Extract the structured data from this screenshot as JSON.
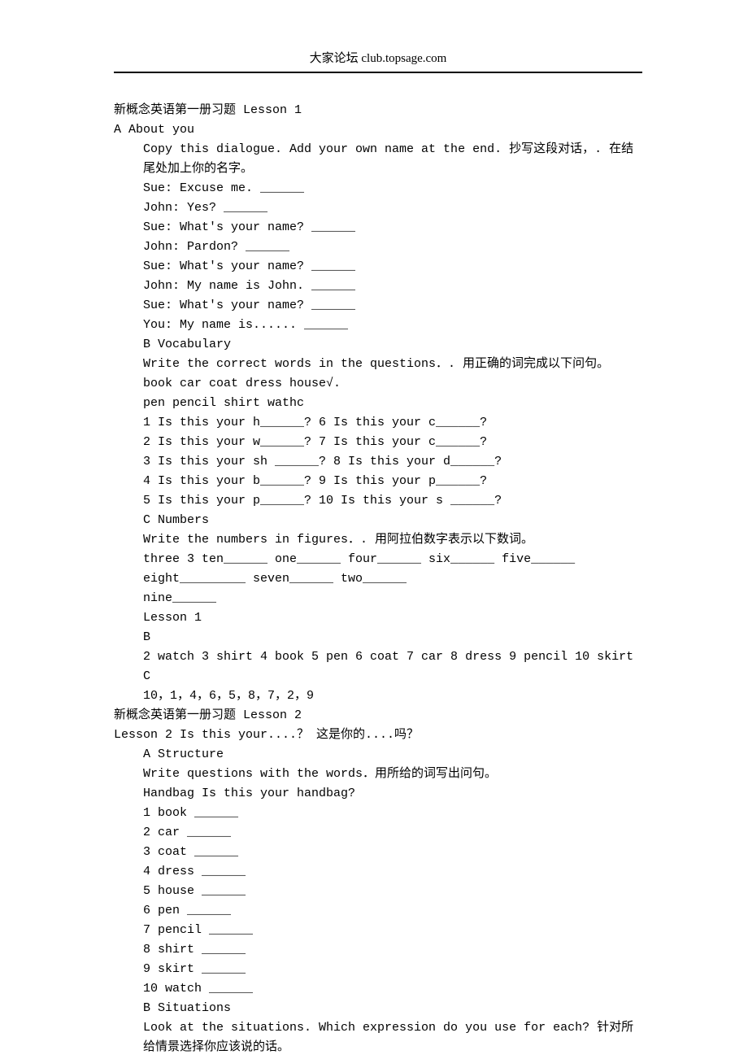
{
  "header": "大家论坛 club.topsage.com",
  "lesson1": {
    "title": "新概念英语第一册习题 Lesson 1",
    "sectionA_label": "A About you",
    "a_instruction": "Copy this dialogue. Add your own name at the end. 抄写这段对话，. 在结尾处加上你的名字。",
    "dialogue": [
      "Sue: Excuse me. ______",
      "John: Yes? ______",
      "Sue: What's your name? ______",
      "John: Pardon? ______",
      "Sue: What's your name? ______",
      "John: My name is John. ______",
      "Sue: What's your name? ______",
      "You: My name is...... ______"
    ],
    "sectionB_label": "B Vocabulary",
    "b_instruction": "Write the correct words in the questions．. 用正确的词完成以下问句。",
    "b_wordlist1": "book car coat dress house√.",
    "b_wordlist2": "pen pencil shirt wathc",
    "b_items": [
      "1 Is this your h______? 6 Is this your c______?",
      "2 Is this your w______? 7 Is this your c______?",
      "3 Is this your sh ______? 8 Is this your d______?",
      "4 Is this your b______? 9 Is this your p______?",
      "5 Is this your p______? 10 Is this your s ______?"
    ],
    "sectionC_label": "C Numbers",
    "c_instruction": "Write the numbers in figures．. 用阿拉伯数字表示以下数词。",
    "c_line1": "three 3 ten______ one______ four______ six______ five______",
    "c_line2": "eight_________ seven______ two______",
    "c_line3": "nine______",
    "answer_heading": "Lesson 1",
    "answer_b_label": "B",
    "answer_b": "2 watch 3 shirt 4 book 5 pen 6 coat 7 car 8 dress 9 pencil 10 skirt",
    "answer_c_label": "C",
    "answer_c": "10，1，4，6，5，8，7，2，9"
  },
  "lesson2": {
    "title": "新概念英语第一册习题 Lesson 2",
    "subtitle": "Lesson 2 Is this your....？ 这是你的....吗？",
    "sectionA_label": "A Structure",
    "a_instruction": "Write questions with the words．用所给的词写出问句。",
    "a_example": "Handbag Is this your handbag?",
    "a_items": [
      "1 book ______",
      "2 car ______",
      "3 coat ______",
      "4 dress ______",
      "5 house ______",
      "6 pen ______",
      "7 pencil ______",
      "8 shirt ______",
      "9 skirt ______",
      "10 watch ______"
    ],
    "sectionB_label": "B Situations",
    "b_instruction": "Look at the situations. Which expression do you use for each? 针对所给情景选择你应该说的话。"
  }
}
